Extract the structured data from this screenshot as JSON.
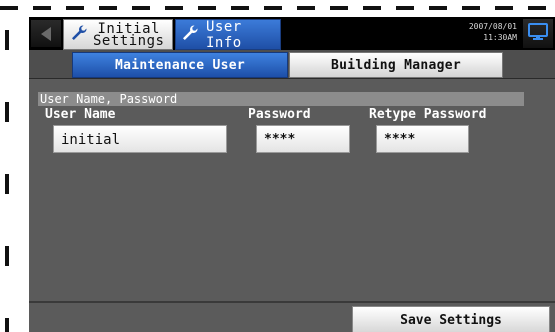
{
  "topbar": {
    "back_icon": "left-arrow-icon",
    "breadcrumb_initial_line1": "Initial",
    "breadcrumb_initial_line2": "Settings",
    "breadcrumb_user_info": "User Info",
    "wrench_icon": "wrench-icon",
    "date": "2007/08/01",
    "time": "11:30AM",
    "monitor_icon": "monitor-icon"
  },
  "tabs": [
    {
      "label": "Maintenance User",
      "active": true
    },
    {
      "label": "Building Manager",
      "active": false
    }
  ],
  "section": {
    "title": "User Name, Password",
    "user_name_label": "User Name",
    "password_label": "Password",
    "retype_password_label": "Retype Password",
    "user_name_value": "initial",
    "password_value": "****",
    "retype_password_value": "****"
  },
  "footer": {
    "save_label": "Save Settings"
  },
  "colors": {
    "active_tab": "#1d4fa8",
    "content_bg": "#5b5b5b",
    "top_bar_bg": "#000000"
  }
}
